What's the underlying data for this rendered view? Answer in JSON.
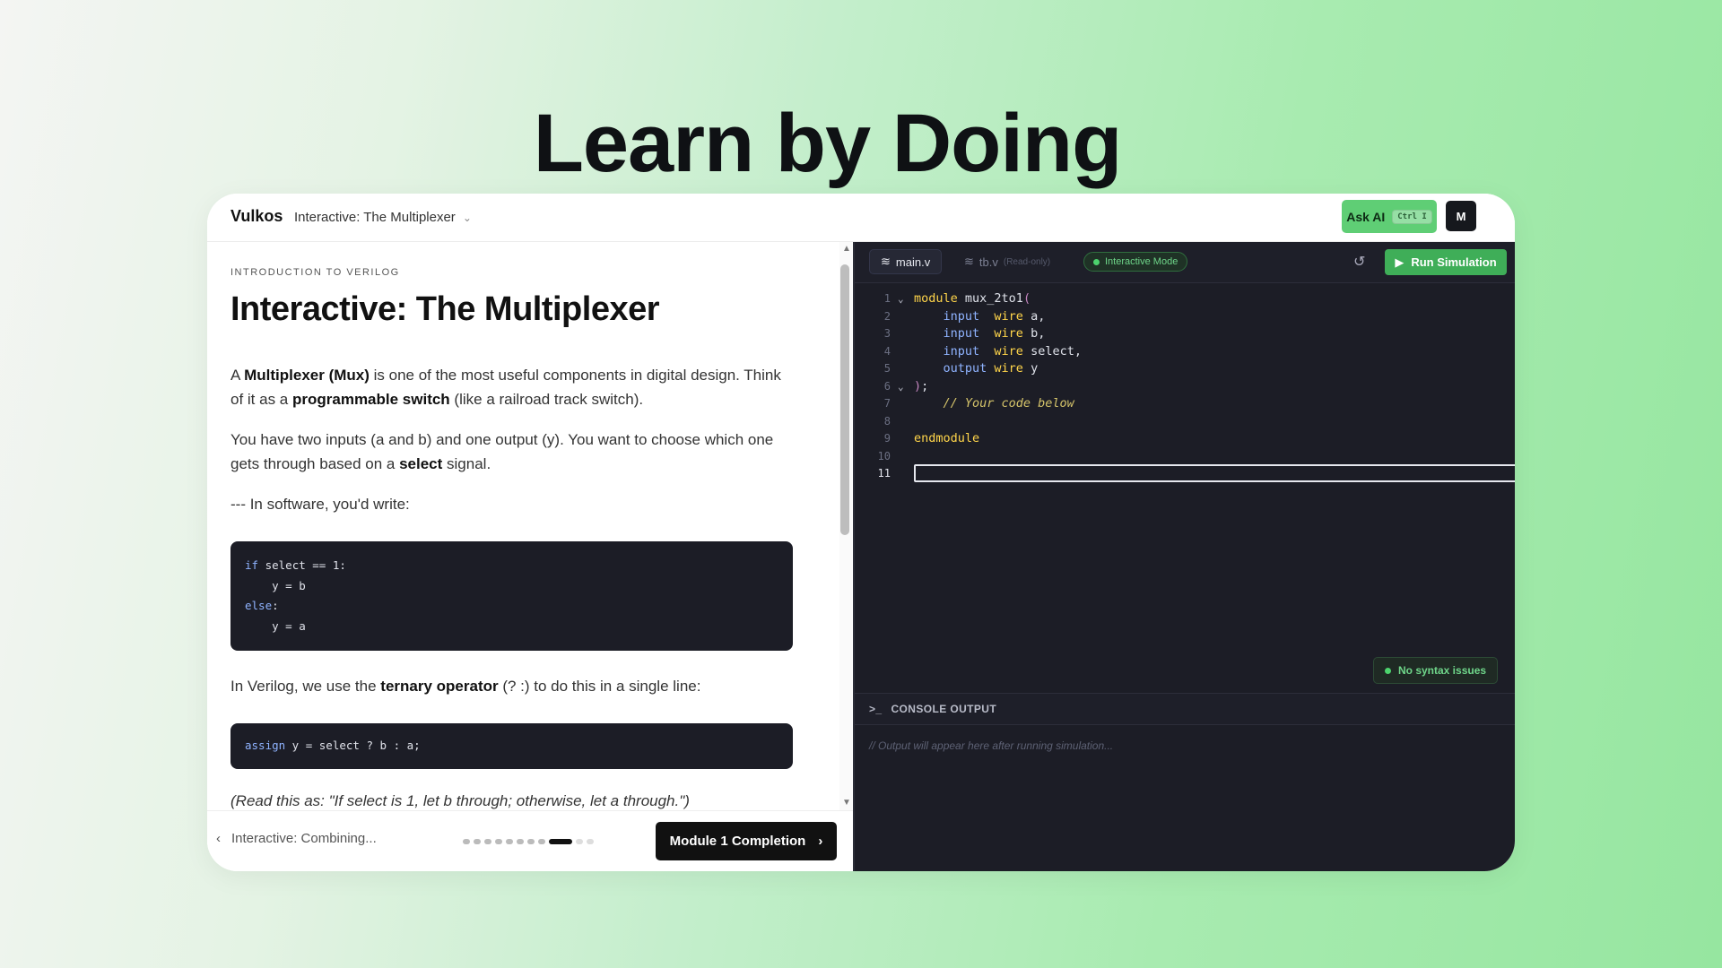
{
  "hero": {
    "title": "Learn by Doing"
  },
  "topbar": {
    "brand": "Vulkos",
    "breadcrumb": "Interactive: The Multiplexer",
    "ask_ai_label": "Ask AI",
    "ask_ai_shortcut": "Ctrl I",
    "avatar_initial": "M"
  },
  "lesson": {
    "eyebrow": "INTRODUCTION TO VERILOG",
    "title": "Interactive: The Multiplexer",
    "p1": {
      "a": "A ",
      "b1": "Multiplexer (Mux)",
      "c": " is one of the most useful components in digital design. Think of it as a ",
      "b2": "programmable switch",
      "d": " (like a railroad track switch)."
    },
    "p2": {
      "a": "You have two inputs (",
      "m1": "a",
      "b": " and ",
      "m2": "b",
      "c": ") and one output (",
      "m3": "y",
      "d": "). You want to choose which one gets through based on a ",
      "bold": "select",
      "e": " signal."
    },
    "p3": "--- In software, you'd write:",
    "code1": {
      "l1_kw": "if",
      "l1_rest": " select == 1:",
      "l2": "    y = b",
      "l3_kw": "else",
      "l3_rest": ":",
      "l4": "    y = a"
    },
    "p4": {
      "a": "In Verilog, we use the ",
      "bold": "ternary operator",
      "b": " (? :) to do this in a single line:"
    },
    "code2": {
      "kw": "assign",
      "rest": " y = select ? b : a;"
    },
    "p5": "(Read this as: \"If select is 1, let b through; otherwise, let a through.\")"
  },
  "footer": {
    "prev_label": "Interactive: Combining...",
    "next_label": "Module 1 Completion",
    "progress": {
      "total": 11,
      "current": 9
    }
  },
  "editor": {
    "tab_main": "main.v",
    "tab_tb": "tb.v",
    "tab_tb_note": "(Read-only)",
    "mode_badge": "Interactive Mode",
    "run_label": "Run Simulation",
    "syntax_status": "No syntax issues",
    "console_title": "CONSOLE OUTPUT",
    "console_placeholder": "// Output will appear here after running simulation...",
    "current_line": 11,
    "lines": [
      {
        "n": "1",
        "kw": "module",
        "rest": " mux_2to1",
        "punc": "("
      },
      {
        "n": "2",
        "indent": "    ",
        "kw": "input",
        "type": "  wire",
        "rest": " a,"
      },
      {
        "n": "3",
        "indent": "    ",
        "kw": "input",
        "type": "  wire",
        "rest": " b,"
      },
      {
        "n": "4",
        "indent": "    ",
        "kw": "input",
        "type": "  wire",
        "rest": " select,"
      },
      {
        "n": "5",
        "indent": "    ",
        "kw": "output",
        "type": " wire",
        "rest": " y"
      },
      {
        "n": "6",
        "punc": ")",
        "rest": ";"
      },
      {
        "n": "7",
        "comment": "    // Your code below"
      },
      {
        "n": "8"
      },
      {
        "n": "9",
        "kw": "endmodule"
      },
      {
        "n": "10"
      },
      {
        "n": "11"
      }
    ]
  },
  "colors": {
    "accent_green": "#5fce75",
    "run_green": "#3fae58",
    "editor_bg": "#1c1d26",
    "keyword_yellow": "#ffd54a",
    "type_blue": "#8fb3ff"
  },
  "icons": [
    "chevron-down-icon",
    "chevron-left-icon",
    "chevron-right-icon",
    "file-icon",
    "play-icon",
    "reset-icon",
    "terminal-icon"
  ]
}
